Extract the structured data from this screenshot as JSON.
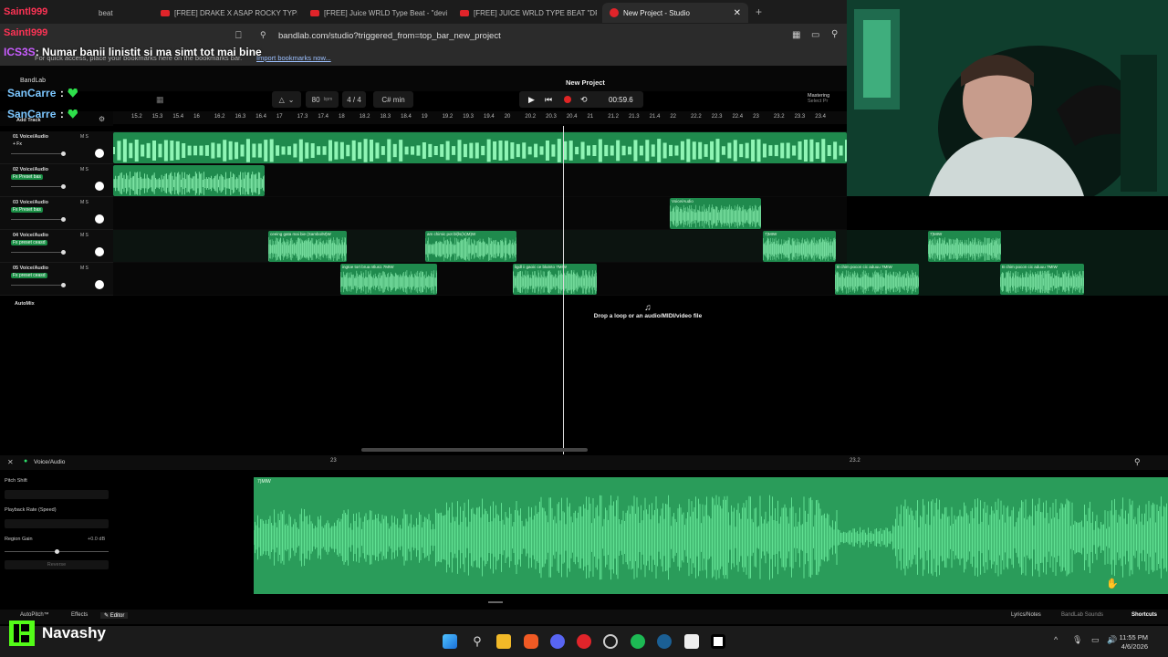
{
  "browser": {
    "tabs": [
      {
        "label": "beat",
        "active": false
      },
      {
        "label": "[FREE] DRAKE X ASAP ROCKY TYPE B",
        "active": false
      },
      {
        "label": "[FREE] Juice WRLD Type Beat - \"devil",
        "active": false
      },
      {
        "label": "[FREE] JUICE WRLD TYPE BEAT \"DRUN",
        "active": false
      },
      {
        "label": "New Project - Studio",
        "active": true
      }
    ],
    "url": "bandlab.com/studio?triggered_from=top_bar_new_project",
    "bookmarks_text": "For quick access, place your bookmarks here on the bookmarks bar.",
    "bookmarks_link": "Import bookmarks now..."
  },
  "chat": [
    {
      "user": "Saintl999",
      "message": ""
    },
    {
      "user": "Saintl999",
      "message": ""
    },
    {
      "user": "ICS3S",
      "message": ": Numar banii linistit si ma simt tot mai bine"
    },
    {
      "user": "SanCarre",
      "message": ":"
    },
    {
      "user": "SanCarre",
      "message": ":"
    }
  ],
  "daw": {
    "project_title": "New Project",
    "logo": "BandLab",
    "tempo": "80",
    "tempo_unit": "bpm",
    "time_signature": "4 / 4",
    "key": "C# min",
    "time": "00:59.6",
    "mastering_label": "Mastering",
    "mastering_sub": "Select Pr",
    "add_track": "Add Track",
    "ruler": [
      "15.2",
      "15.3",
      "15.4",
      "16",
      "16.2",
      "16.3",
      "16.4",
      "17",
      "17.3",
      "17.4",
      "18",
      "18.2",
      "18.3",
      "18.4",
      "19",
      "19.2",
      "19.3",
      "19.4",
      "20",
      "20.2",
      "20.3",
      "20.4",
      "21",
      "21.2",
      "21.3",
      "21.4",
      "22",
      "22.2",
      "22.3",
      "22.4",
      "23",
      "23.2",
      "23.3",
      "23.4"
    ],
    "tracks": [
      {
        "name": "01 Voice/Audio",
        "fx": "+ Fx"
      },
      {
        "name": "02 Voice/Audio",
        "fx": "Fx Preset bas"
      },
      {
        "name": "03 Voice/Audio",
        "fx": "Fx Preset bas"
      },
      {
        "name": "04 Voice/Audio",
        "fx": "Fx preset ceasd"
      },
      {
        "name": "05 Voice/Audio",
        "fx": "Fx preset ceasd"
      }
    ],
    "clips": {
      "t3": [
        "Voice/Audio"
      ],
      "t4": [
        "ceeing gata mai bie (Sambo/M)W",
        "am chimic pot bl(ls(/s)M)W",
        "7)MIW",
        "7)MIW"
      ],
      "t5": [
        "ingtoe tort brua ntlus1 7MIW",
        "ligdl ii gaoic ce blutnto 7MIW",
        "B chim pocon cic aduuu 7MIW",
        "B chim pocon cic aduuu 7MIW"
      ]
    },
    "automix": "AutoMix",
    "drop_hint": "Drop a loop or an audio/MIDI/video file",
    "ms": "M  S"
  },
  "editor": {
    "track_label": "Voice/Audio",
    "ruler_marks": [
      "23",
      "23.2"
    ],
    "clip_label": "7)MIW",
    "pitch_shift": "Pitch Shift",
    "playback_rate": "Playback Rate (Speed)",
    "region_gain": "Region Gain",
    "region_gain_value": "+0.0 dB",
    "reverse": "Reverse"
  },
  "bottom_bar": {
    "autopitch": "AutoPitch™",
    "effects": "Effects",
    "editor": "Editor",
    "lyrics": "Lyrics/Notes",
    "sounds": "BandLab Sounds",
    "shortcuts": "Shortcuts"
  },
  "kick": {
    "name": "Navashy"
  },
  "taskbar": {
    "time": "11:55 PM",
    "date": "4/6/2026"
  }
}
